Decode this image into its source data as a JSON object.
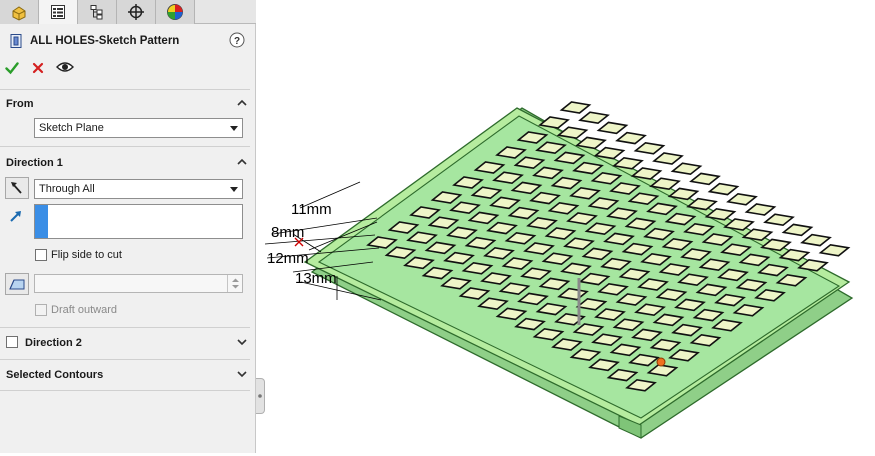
{
  "feature": {
    "title": "ALL HOLES-Sketch Pattern"
  },
  "tabs": [
    {
      "name": "feature-manager-tab",
      "icon": "feature-manager-icon"
    },
    {
      "name": "property-manager-tab",
      "icon": "property-manager-icon"
    },
    {
      "name": "configuration-manager-tab",
      "icon": "configuration-manager-icon"
    },
    {
      "name": "dimxpert-manager-tab",
      "icon": "crosshair-icon"
    },
    {
      "name": "display-manager-tab",
      "icon": "appearance-icon"
    }
  ],
  "from": {
    "label": "From",
    "selected": "Sketch Plane"
  },
  "direction1": {
    "label": "Direction 1",
    "end_condition": "Through All",
    "flip_label": "Flip side to cut",
    "draft_label": "Draft outward"
  },
  "direction2": {
    "label": "Direction 2"
  },
  "selected_contours": {
    "label": "Selected Contours"
  },
  "dimensions": [
    "11mm",
    "8mm",
    "12mm",
    "13mm"
  ],
  "colors": {
    "accent": "#3a8ee6",
    "confirm": "#2a9d2a",
    "cancel": "#d42020",
    "model_face": "#a6e6a0",
    "model_edge": "#2e6b2c",
    "hole_fill": "#eef5c8"
  }
}
